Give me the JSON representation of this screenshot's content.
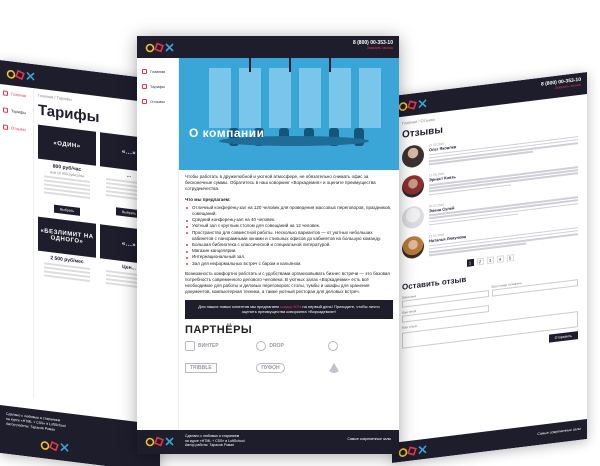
{
  "colors": {
    "dark": "#1d1d2c",
    "accent": "#e8354d",
    "hero_blue": "#3aa6d8"
  },
  "left": {
    "nav": [
      "Главная",
      "Тарифы",
      "Отзывы"
    ],
    "breadcrumbs": "Главная / Тарифы",
    "title": "Тарифы",
    "tariffs": [
      {
        "name": "«ОДИН»",
        "price": "800 руб/час",
        "sub": "или 10 000 руб/сутки"
      },
      {
        "name": "«...»",
        "price": "...",
        "sub": ""
      },
      {
        "name": "«БЕЗЛИМИТ НА ОДНОГО»",
        "price": "2 500 руб/мес",
        "sub": ""
      },
      {
        "name": "«...»",
        "price": "Цен...",
        "sub": ""
      }
    ],
    "button": "Выбрать",
    "footer": [
      "Сделано с любовью и старанием",
      "на курсе «HTML + CSS» в LoftSchool",
      "Автор работы: Тарасов Роман"
    ]
  },
  "center": {
    "phone": "8 (800) 00-353-10",
    "phone_sub": "Заказать звонок",
    "nav": [
      "Главная",
      "Тарифы",
      "Отзывы"
    ],
    "hero_title": "О компании",
    "intro": "Чтобы работать в дружелюбной и уютной атмосфере, не обязательно снимать офис за бесконечные суммы. Обратитесь в наш коворкинг «Воркадемия» и оцените преимущества сотрудничества.",
    "list_heading": "Что мы предлагаем:",
    "offers": [
      "Отличный конференц-зал на 120 человек для проведения массовых переговоров, праздников, совещаний.",
      "Средний конференц-зал на 40 человек.",
      "Уютный зал с круглым столом для совещаний на 12 человек.",
      "Пространство для совместной работы. Несколько вариантов — от уютных небольших кабинетов с панорамными окнами и стильных офисов до кабинетов на большую команду.",
      "Большая библиотека с классической и специальной литературой.",
      "Магазин канцелярии.",
      "Интернациональный зал.",
      "Зал для неформальных встреч с баром и кальяном."
    ],
    "outro": "Возможность комфортно работать и с удобствами организовывать бизнес встречи — это базовая потребность современного делового человека. В уютных залах «Воркадемии» есть всё необходимое для работы и деловых переговоров: столы, тумбы и шкафы для хранения документов, компьютерная техника, а также уютный ресторан для деловых встреч.",
    "promo_before": "Для наших новых клиентов мы предлагаем",
    "promo_accent": "скидку 50%",
    "promo_after": "на первый день! Приходите, чтобы лично оценить преимущества коворкинга «Воркадемия»!",
    "partners_title": "ПАРТНЁРЫ",
    "partners": [
      "ВИНТЕР",
      "DROP",
      "",
      "TRIBBLE",
      "ПУФОН",
      ""
    ],
    "footer": [
      "Сделано с любовью и старанием",
      "на курсе «HTML + CSS» в LoftSchool",
      "Автор работы: Тарасов Роман"
    ],
    "footer_right": "Самые современные залы"
  },
  "right": {
    "phone": "8 (800) 00-353-10",
    "phone_sub": "Заказать звонок",
    "breadcrumbs": "Главная / Отзывы",
    "title": "Отзывы",
    "reviews": [
      {
        "date": "21.02.2018",
        "name": "Олег Яковлев"
      },
      {
        "date": "12.08.2018",
        "name": "Эрнест Князь"
      },
      {
        "date": "07.02.2018",
        "name": "Элена Сулей"
      },
      {
        "date": "12.02.2018",
        "name": "Наталья Ляпунова"
      }
    ],
    "pages": [
      "1",
      "2",
      "3",
      "4",
      "5"
    ],
    "form_title": "Оставить отзыв",
    "form_labels": [
      "Ваше имя",
      "Ваш номер телефона",
      "Ваш email",
      "Ваш отзыв"
    ],
    "send": "Отправить",
    "footer_right": "Самые современные залы"
  }
}
